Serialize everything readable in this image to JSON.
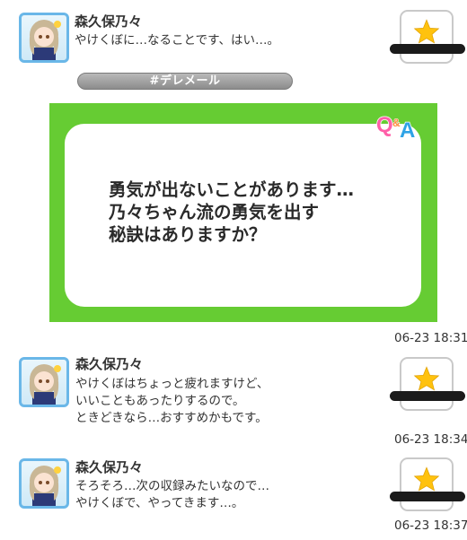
{
  "header": {
    "sender": "森久保乃々",
    "message_lines": [
      "やけくぼに…なることです、はい…。"
    ]
  },
  "tag": {
    "label": "#デレメール"
  },
  "qa_card": {
    "logo": "Q&A",
    "question_lines": [
      "勇気が出ないことがあります…",
      "乃々ちゃん流の勇気を出す",
      "秘訣はありますか？"
    ],
    "timestamp": "06-23 18:31",
    "bg_color": "#66cc33"
  },
  "replies": [
    {
      "sender": "森久保乃々",
      "message_lines": [
        "やけくぼはちょっと疲れますけど、",
        "いいこともあったりするので。",
        "ときどきなら…おすすめかもです。"
      ],
      "timestamp": "06-23 18:34"
    },
    {
      "sender": "森久保乃々",
      "message_lines": [
        "そろそろ…次の収録みたいなので…",
        "やけくぼで、やってきます…。"
      ],
      "timestamp": "06-23 18:37"
    }
  ],
  "icons": {
    "favorite": "star-icon",
    "avatar": "character-avatar-icon"
  },
  "colors": {
    "star": "#ffc20e",
    "avatar_border": "#6ab7e8",
    "qa_green": "#66cc33"
  }
}
